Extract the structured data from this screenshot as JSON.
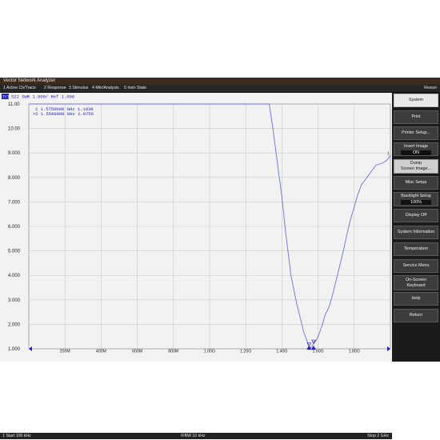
{
  "window": {
    "title": "Vector Network Analyzer"
  },
  "menu": {
    "items": [
      "1 Active Ch/Trace",
      "2 Response",
      "3 Stimulus",
      "4 Mkr/Analysis",
      "5 Instr State"
    ],
    "resize_label": "Resize"
  },
  "trace_header": {
    "channel_tag": "Tr1",
    "label": "S22 SWR 1.000/ Ref 1.000"
  },
  "markers": [
    {
      "id": "1",
      "active": false,
      "freq": "1.5750000 GHz",
      "value": "1.1939"
    },
    {
      "id": "2",
      "active": true,
      "freq": "1.5500000 GHz",
      "value": "1.0756"
    }
  ],
  "marker_list_text": [
    "1  1.5750000 GHz  1.1939",
    ">2  1.5500000 GHz  1.0756"
  ],
  "softkeys": [
    {
      "label": "System",
      "style": "header"
    },
    {
      "label": "Print"
    },
    {
      "label": "Printer Setup..."
    },
    {
      "label": "Invert Image",
      "value": "ON"
    },
    {
      "label": "Dump",
      "label2": "Screen Image...",
      "style": "active"
    },
    {
      "label": "Misc Setup"
    },
    {
      "label": "Backlight Setup",
      "value": "100%"
    },
    {
      "label": "Display Off"
    },
    {
      "label": "System Information"
    },
    {
      "label": "Temperature"
    },
    {
      "label": "Service Menu"
    },
    {
      "label": "On-Screen",
      "label2": "Keyboard"
    },
    {
      "label": "Help"
    },
    {
      "label": "Return"
    }
  ],
  "statusbar": {
    "start": "1  Start 100 kHz",
    "ifbw": "IFBW 10 kHz",
    "stop": "Stop 2 GHz"
  },
  "colors": {
    "trace": "#6d6fe0",
    "grid": "#c9c9c9",
    "plot_bg": "#f2f2f2",
    "annotation": "#2020c0"
  },
  "chart_data": {
    "type": "line",
    "title": "S22 SWR 1.000/ Ref 1.000",
    "xlabel": "",
    "ylabel": "",
    "xlim": [
      0.0001,
      2.0
    ],
    "ylim": [
      1.0,
      11.0
    ],
    "x_unit": "GHz",
    "y_ticks": [
      "1.000",
      "2.000",
      "3.000",
      "4.000",
      "5.000",
      "6.000",
      "7.000",
      "8.000",
      "9.000",
      "10.00",
      "11.00"
    ],
    "x_ticks": [
      "200M",
      "400M",
      "600M",
      "800M",
      "1.00G",
      "1.20G",
      "1.40G",
      "1.60G",
      "1.80G"
    ],
    "x_tick_values": [
      0.2,
      0.4,
      0.6,
      0.8,
      1.0,
      1.2,
      1.4,
      1.6,
      1.8
    ],
    "grid": true,
    "series": [
      {
        "x": [
          0.0001,
          0.2,
          0.4,
          0.6,
          0.8,
          1.0,
          1.2,
          1.33,
          1.35,
          1.38,
          1.4,
          1.42,
          1.45,
          1.48,
          1.5,
          1.52,
          1.54,
          1.55,
          1.56,
          1.575,
          1.59,
          1.6,
          1.62,
          1.64,
          1.66,
          1.68,
          1.7,
          1.72,
          1.74,
          1.76,
          1.78,
          1.8,
          1.82,
          1.84,
          1.86,
          1.88,
          1.9,
          1.92,
          1.94,
          1.96,
          1.98,
          2.0
        ],
        "y": [
          11.0,
          11.0,
          11.0,
          11.0,
          11.0,
          11.0,
          11.0,
          11.0,
          10.0,
          8.3,
          7.2,
          5.8,
          4.0,
          2.9,
          2.3,
          1.7,
          1.3,
          1.08,
          1.05,
          1.19,
          1.35,
          1.5,
          1.9,
          2.4,
          2.7,
          3.2,
          3.8,
          4.4,
          5.0,
          5.7,
          6.3,
          6.8,
          7.3,
          7.7,
          7.9,
          8.1,
          8.3,
          8.5,
          8.55,
          8.6,
          8.7,
          8.9
        ]
      }
    ],
    "marker_points": [
      {
        "id": "1",
        "x": 1.575,
        "y": 1.1939
      },
      {
        "id": "2",
        "x": 1.55,
        "y": 1.0756
      }
    ]
  }
}
